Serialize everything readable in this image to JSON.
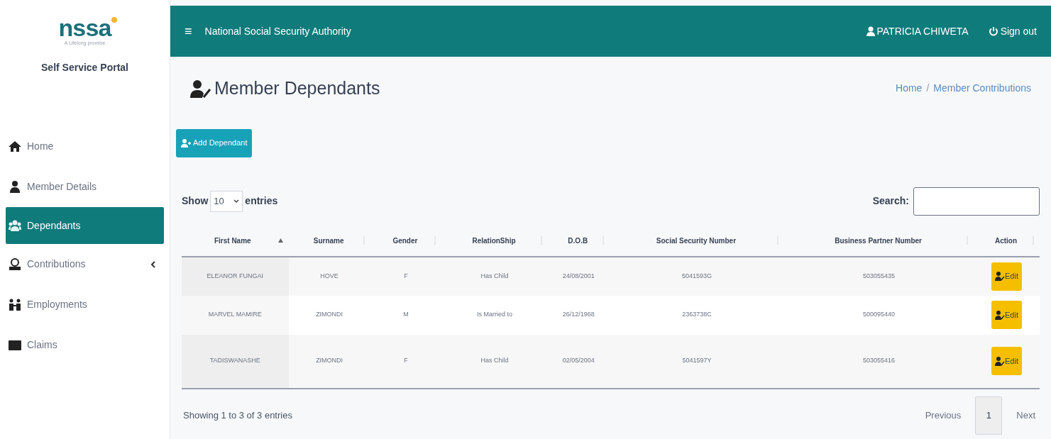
{
  "sidebar": {
    "logo": "nssa",
    "tagline": "A Lifelong promise",
    "portal_title": "Self Service Portal",
    "items": [
      {
        "label": "Home",
        "selected": false
      },
      {
        "label": "Member Details",
        "selected": false
      },
      {
        "label": "Dependants",
        "selected": true
      },
      {
        "label": "Contributions",
        "selected": false,
        "has_submenu": true
      },
      {
        "label": "Employments",
        "selected": false
      },
      {
        "label": "Claims",
        "selected": false
      }
    ]
  },
  "top_bar": {
    "menu_glyph": "≡",
    "title": "National Social Security Authority",
    "user": "PATRICIA CHIWETA",
    "sign_out": "Sign out"
  },
  "page": {
    "title": "Member Dependants",
    "breadcrumb": [
      "Home",
      "Member Contributions"
    ],
    "breadcrumb_separator": "/",
    "add_button": "Add Dependant"
  },
  "table_controls": {
    "show_label": "Show",
    "page_size": "10",
    "entries_label": "entries",
    "search_label": "Search:"
  },
  "table": {
    "columns": [
      {
        "label": "First Name",
        "sorted": true
      },
      {
        "label": "Surname",
        "sorted": false
      },
      {
        "label": "Gender",
        "sorted": false
      },
      {
        "label": "RelationShip",
        "sorted": false
      },
      {
        "label": "D.O.B",
        "sorted": false
      },
      {
        "label": "Social Security Number",
        "sorted": false
      },
      {
        "label": "Business Partner Number",
        "sorted": false
      },
      {
        "label": "Action",
        "sorted": false
      }
    ],
    "rows": [
      {
        "cells": [
          "ELEANOR FUNGAI",
          "HOVE",
          "F",
          "Has Child",
          "24/08/2001",
          "5041593G",
          "503055435"
        ],
        "action": "Edit"
      },
      {
        "cells": [
          "MARVEL MAMIRE",
          "ZIMONDI",
          "M",
          "Is Married to",
          "26/12/1968",
          "2363738C",
          "500095440"
        ],
        "action": "Edit"
      },
      {
        "cells": [
          "TADISWANASHE",
          "ZIMONDI",
          "F",
          "Has Child",
          "02/05/2004",
          "5041597Y",
          "503055416"
        ],
        "action": "Edit"
      }
    ]
  },
  "footer": {
    "info": "Showing 1 to 3 of 3 entries",
    "pagination": [
      {
        "label": "Previous",
        "selected": false
      },
      {
        "label": "1",
        "selected": true
      },
      {
        "label": "Next",
        "selected": false
      }
    ]
  }
}
